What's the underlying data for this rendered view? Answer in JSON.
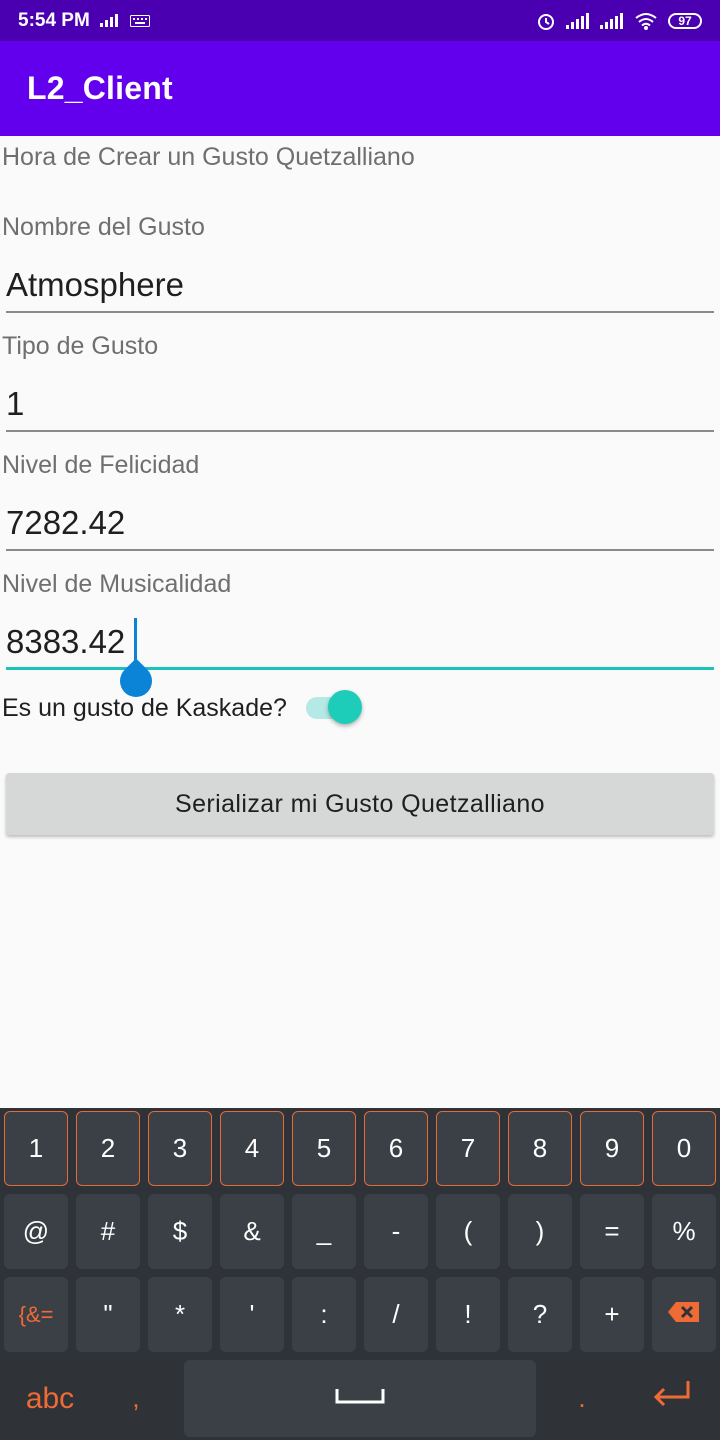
{
  "status_bar": {
    "time": "5:54 PM",
    "battery": "97"
  },
  "app_bar": {
    "title": "L2_Client"
  },
  "form": {
    "heading": "Hora de Crear un Gusto Quetzalliano",
    "name_label": "Nombre del Gusto",
    "name_value": "Atmosphere",
    "type_label": "Tipo de Gusto",
    "type_value": "1",
    "happiness_label": "Nivel de Felicidad",
    "happiness_value": "7282.42",
    "musicality_label": "Nivel de Musicalidad",
    "musicality_value": "8383.42",
    "switch_label": "Es un gusto de Kaskade?",
    "switch_on": true,
    "button_label": "Serializar mi Gusto Quetzalliano"
  },
  "keyboard": {
    "row1": [
      "1",
      "2",
      "3",
      "4",
      "5",
      "6",
      "7",
      "8",
      "9",
      "0"
    ],
    "row2": [
      "@",
      "#",
      "$",
      "&",
      "_",
      "-",
      "(",
      ")",
      "=",
      "%"
    ],
    "row3": [
      "{&=",
      "\"",
      "*",
      "'",
      ":",
      "/",
      "!",
      "?",
      "+"
    ],
    "bottom": {
      "abc": "abc",
      "comma": ",",
      "period": "."
    },
    "accent_color": "#f06a35"
  }
}
